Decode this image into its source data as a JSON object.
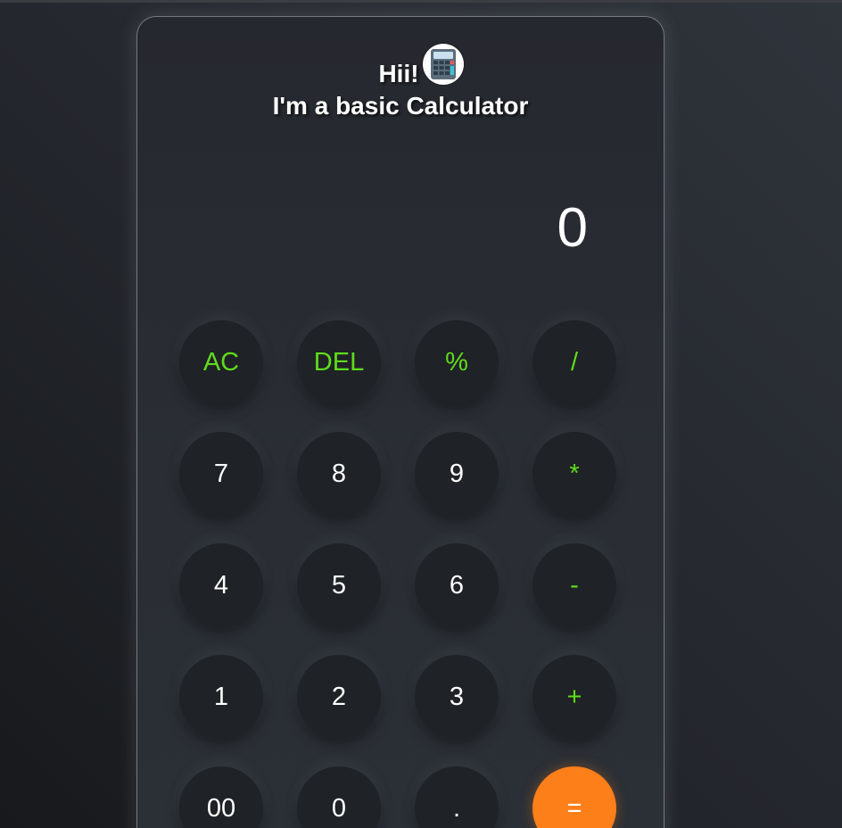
{
  "header": {
    "greeting": "Hii!",
    "subtitle": "I'm a basic Calculator",
    "emoji": "calculator-icon"
  },
  "display": {
    "value": "0"
  },
  "keys": [
    {
      "label": "AC",
      "type": "op"
    },
    {
      "label": "DEL",
      "type": "op"
    },
    {
      "label": "%",
      "type": "op"
    },
    {
      "label": "/",
      "type": "op"
    },
    {
      "label": "7",
      "type": "num"
    },
    {
      "label": "8",
      "type": "num"
    },
    {
      "label": "9",
      "type": "num"
    },
    {
      "label": "*",
      "type": "op"
    },
    {
      "label": "4",
      "type": "num"
    },
    {
      "label": "5",
      "type": "num"
    },
    {
      "label": "6",
      "type": "num"
    },
    {
      "label": "-",
      "type": "op"
    },
    {
      "label": "1",
      "type": "num"
    },
    {
      "label": "2",
      "type": "num"
    },
    {
      "label": "3",
      "type": "num"
    },
    {
      "label": "+",
      "type": "op"
    },
    {
      "label": "00",
      "type": "num"
    },
    {
      "label": "0",
      "type": "num"
    },
    {
      "label": ".",
      "type": "num"
    },
    {
      "label": "=",
      "type": "eq"
    }
  ],
  "colors": {
    "operator": "#5fdc1b",
    "equals": "#fd7f1a",
    "key_background": "#1f2226",
    "text": "#ffffff"
  }
}
